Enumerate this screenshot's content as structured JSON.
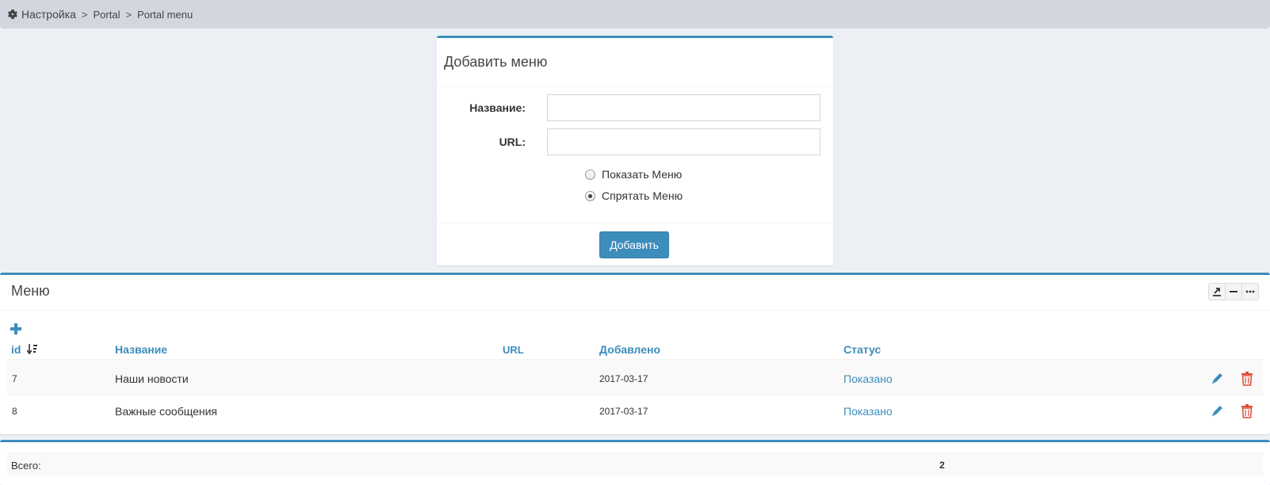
{
  "breadcrumb": {
    "items": [
      "Настройка",
      "Portal",
      "Portal menu"
    ],
    "separator": ">"
  },
  "add_form": {
    "title": "Добавить меню",
    "name_label": "Название:",
    "name_value": "",
    "url_label": "URL:",
    "url_value": "",
    "radio_show": "Показать Меню",
    "radio_hide": "Спрятать Меню",
    "selected": "hide",
    "submit_label": "Добавить"
  },
  "menu_list": {
    "title": "Меню",
    "tools": [
      "export-icon",
      "collapse-icon",
      "more-icon"
    ],
    "columns": {
      "id": "id",
      "name": "Название",
      "url": "URL",
      "added": "Добавлено",
      "status": "Статус"
    },
    "rows": [
      {
        "id": "7",
        "name": "Наши новости",
        "url": "",
        "added": "2017-03-17",
        "status": "Показано"
      },
      {
        "id": "8",
        "name": "Важные сообщения",
        "url": "",
        "added": "2017-03-17",
        "status": "Показано"
      }
    ]
  },
  "totals": {
    "label": "Всего:",
    "value": "2"
  },
  "colors": {
    "accent": "#3c8dbc",
    "danger": "#dd4b39",
    "background": "#ecf0f5"
  }
}
